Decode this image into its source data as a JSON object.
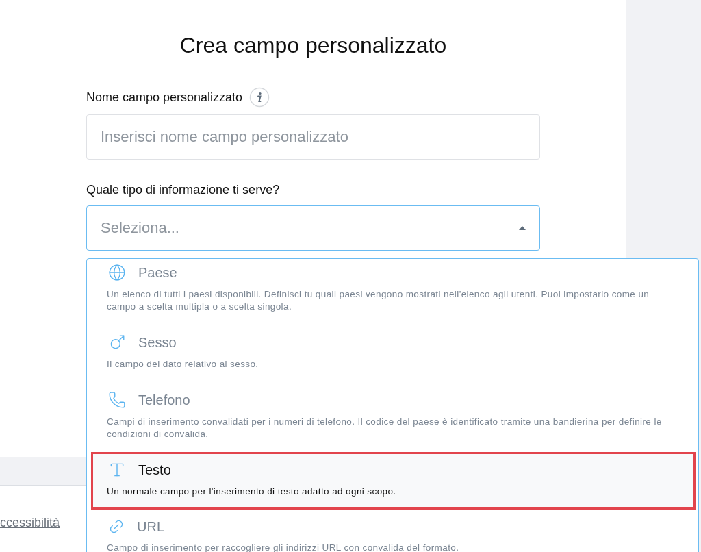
{
  "title": "Crea campo personalizzato",
  "name_field": {
    "label": "Nome campo personalizzato",
    "placeholder": "Inserisci nome campo personalizzato"
  },
  "type_select": {
    "label": "Quale tipo di informazione ti serve?",
    "placeholder": "Seleziona...",
    "expanded": true,
    "options": [
      {
        "kind": "globe",
        "name": "Paese",
        "description": "Un elenco di tutti i paesi disponibili. Definisci tu quali paesi vengono mostrati nell'elenco agli utenti. Puoi impostarlo come un campo a scelta multipla o a scelta singola.",
        "highlighted": false
      },
      {
        "kind": "gender",
        "name": "Sesso",
        "description": "Il campo del dato relativo al sesso.",
        "highlighted": false
      },
      {
        "kind": "phone",
        "name": "Telefono",
        "description": "Campi di inserimento convalidati per i numeri di telefono. Il codice del paese è identificato tramite una bandierina per definire le condizioni di convalida.",
        "highlighted": false
      },
      {
        "kind": "text",
        "name": "Testo",
        "description": "Un normale campo per l'inserimento di testo adatto ad ogni scopo.",
        "highlighted": true
      },
      {
        "kind": "link",
        "name": "URL",
        "description": "Campo di inserimento per raccogliere gli indirizzi URL con convalida del formato.",
        "highlighted": false
      }
    ]
  },
  "footer": {
    "link": "ccessibilità"
  }
}
